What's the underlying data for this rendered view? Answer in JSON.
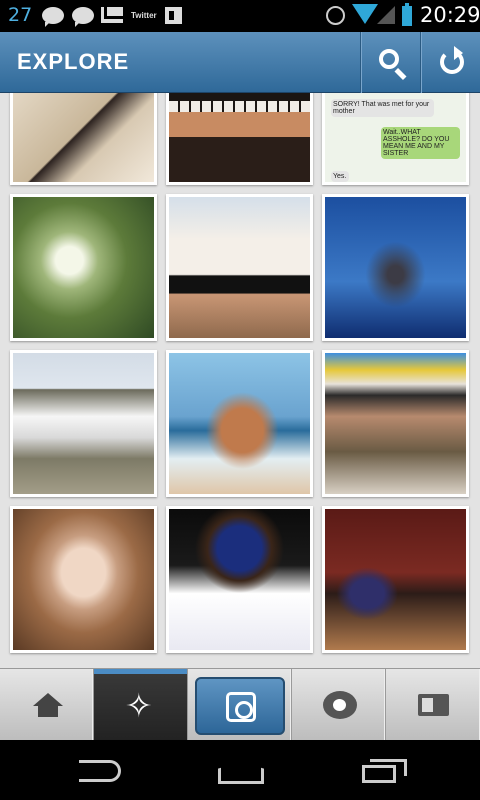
{
  "status_bar": {
    "notification_count": "27",
    "icons": [
      "chat-icon",
      "chat-icon",
      "gmail-icon",
      "twitter-icon",
      "flipboard-icon",
      "alarm-icon",
      "wifi-icon",
      "signal-icon",
      "battery-icon"
    ],
    "twitter_text": "Twitter",
    "time": "20:29"
  },
  "header": {
    "title": "EXPLORE",
    "buttons": [
      "search-icon",
      "refresh-icon"
    ]
  },
  "grid": {
    "photos": [
      {
        "subject": "Model in black swimwear",
        "colors": [
          "#e6d9c4",
          "#c9b79a",
          "#2d2320"
        ]
      },
      {
        "subject": "Hand on piano keys",
        "colors": [
          "#1a1512",
          "#c88b62",
          "#e7e2dc"
        ]
      },
      {
        "subject": "Text message screenshot",
        "colors": [
          "#eef3ea",
          "#a8d77a",
          "#d6d6d6"
        ],
        "text_lines": [
          "SORRY! That was met for your mother",
          "Wait..WHAT ASSHOLE? DO YOU MEAN ME AND MY SISTER",
          "Yes."
        ]
      },
      {
        "subject": "Palm trees and sunlight",
        "colors": [
          "#d7eadf",
          "#5d7b3a",
          "#2f4a24"
        ]
      },
      {
        "subject": "Woman in white top",
        "colors": [
          "#d5dfe9",
          "#f4efe8",
          "#8f6a4d"
        ]
      },
      {
        "subject": "Bare tree under blue sky",
        "colors": [
          "#1c4fa0",
          "#3c79c6",
          "#0f2d70"
        ]
      },
      {
        "subject": "White sports car parked",
        "colors": [
          "#dfe6ee",
          "#f6f6f6",
          "#6b6a5b"
        ]
      },
      {
        "subject": "Woman in bikini on beach",
        "colors": [
          "#8dc4e6",
          "#c07a4c",
          "#dfc6a8"
        ]
      },
      {
        "subject": "Person being lifted at party",
        "colors": [
          "#6a5b44",
          "#e7e2da",
          "#b78a6e"
        ]
      },
      {
        "subject": "Girl portrait close-up",
        "colors": [
          "#9b6a46",
          "#f0d7c5",
          "#c79d80"
        ]
      },
      {
        "subject": "Football player number 16",
        "colors": [
          "#1b2e7d",
          "#ffffff",
          "#3a2518"
        ]
      },
      {
        "subject": "Fashion runway model",
        "colors": [
          "#5a1a16",
          "#2f2f6a",
          "#b07a4d"
        ]
      }
    ]
  },
  "tab_bar": {
    "tabs": [
      {
        "name": "home",
        "icon": "home-icon",
        "active": false
      },
      {
        "name": "explore",
        "icon": "star-icon",
        "active": true
      },
      {
        "name": "camera",
        "icon": "camera-icon",
        "active": false
      },
      {
        "name": "news",
        "icon": "heart-bubble-icon",
        "active": false
      },
      {
        "name": "profile",
        "icon": "profile-card-icon",
        "active": false
      }
    ]
  },
  "nav_bar": {
    "buttons": [
      "back-icon",
      "home-icon",
      "recent-apps-icon"
    ]
  },
  "colors": {
    "accent": "#3e77a8",
    "header_top": "#5d91bc",
    "header_bottom": "#2f6999"
  }
}
